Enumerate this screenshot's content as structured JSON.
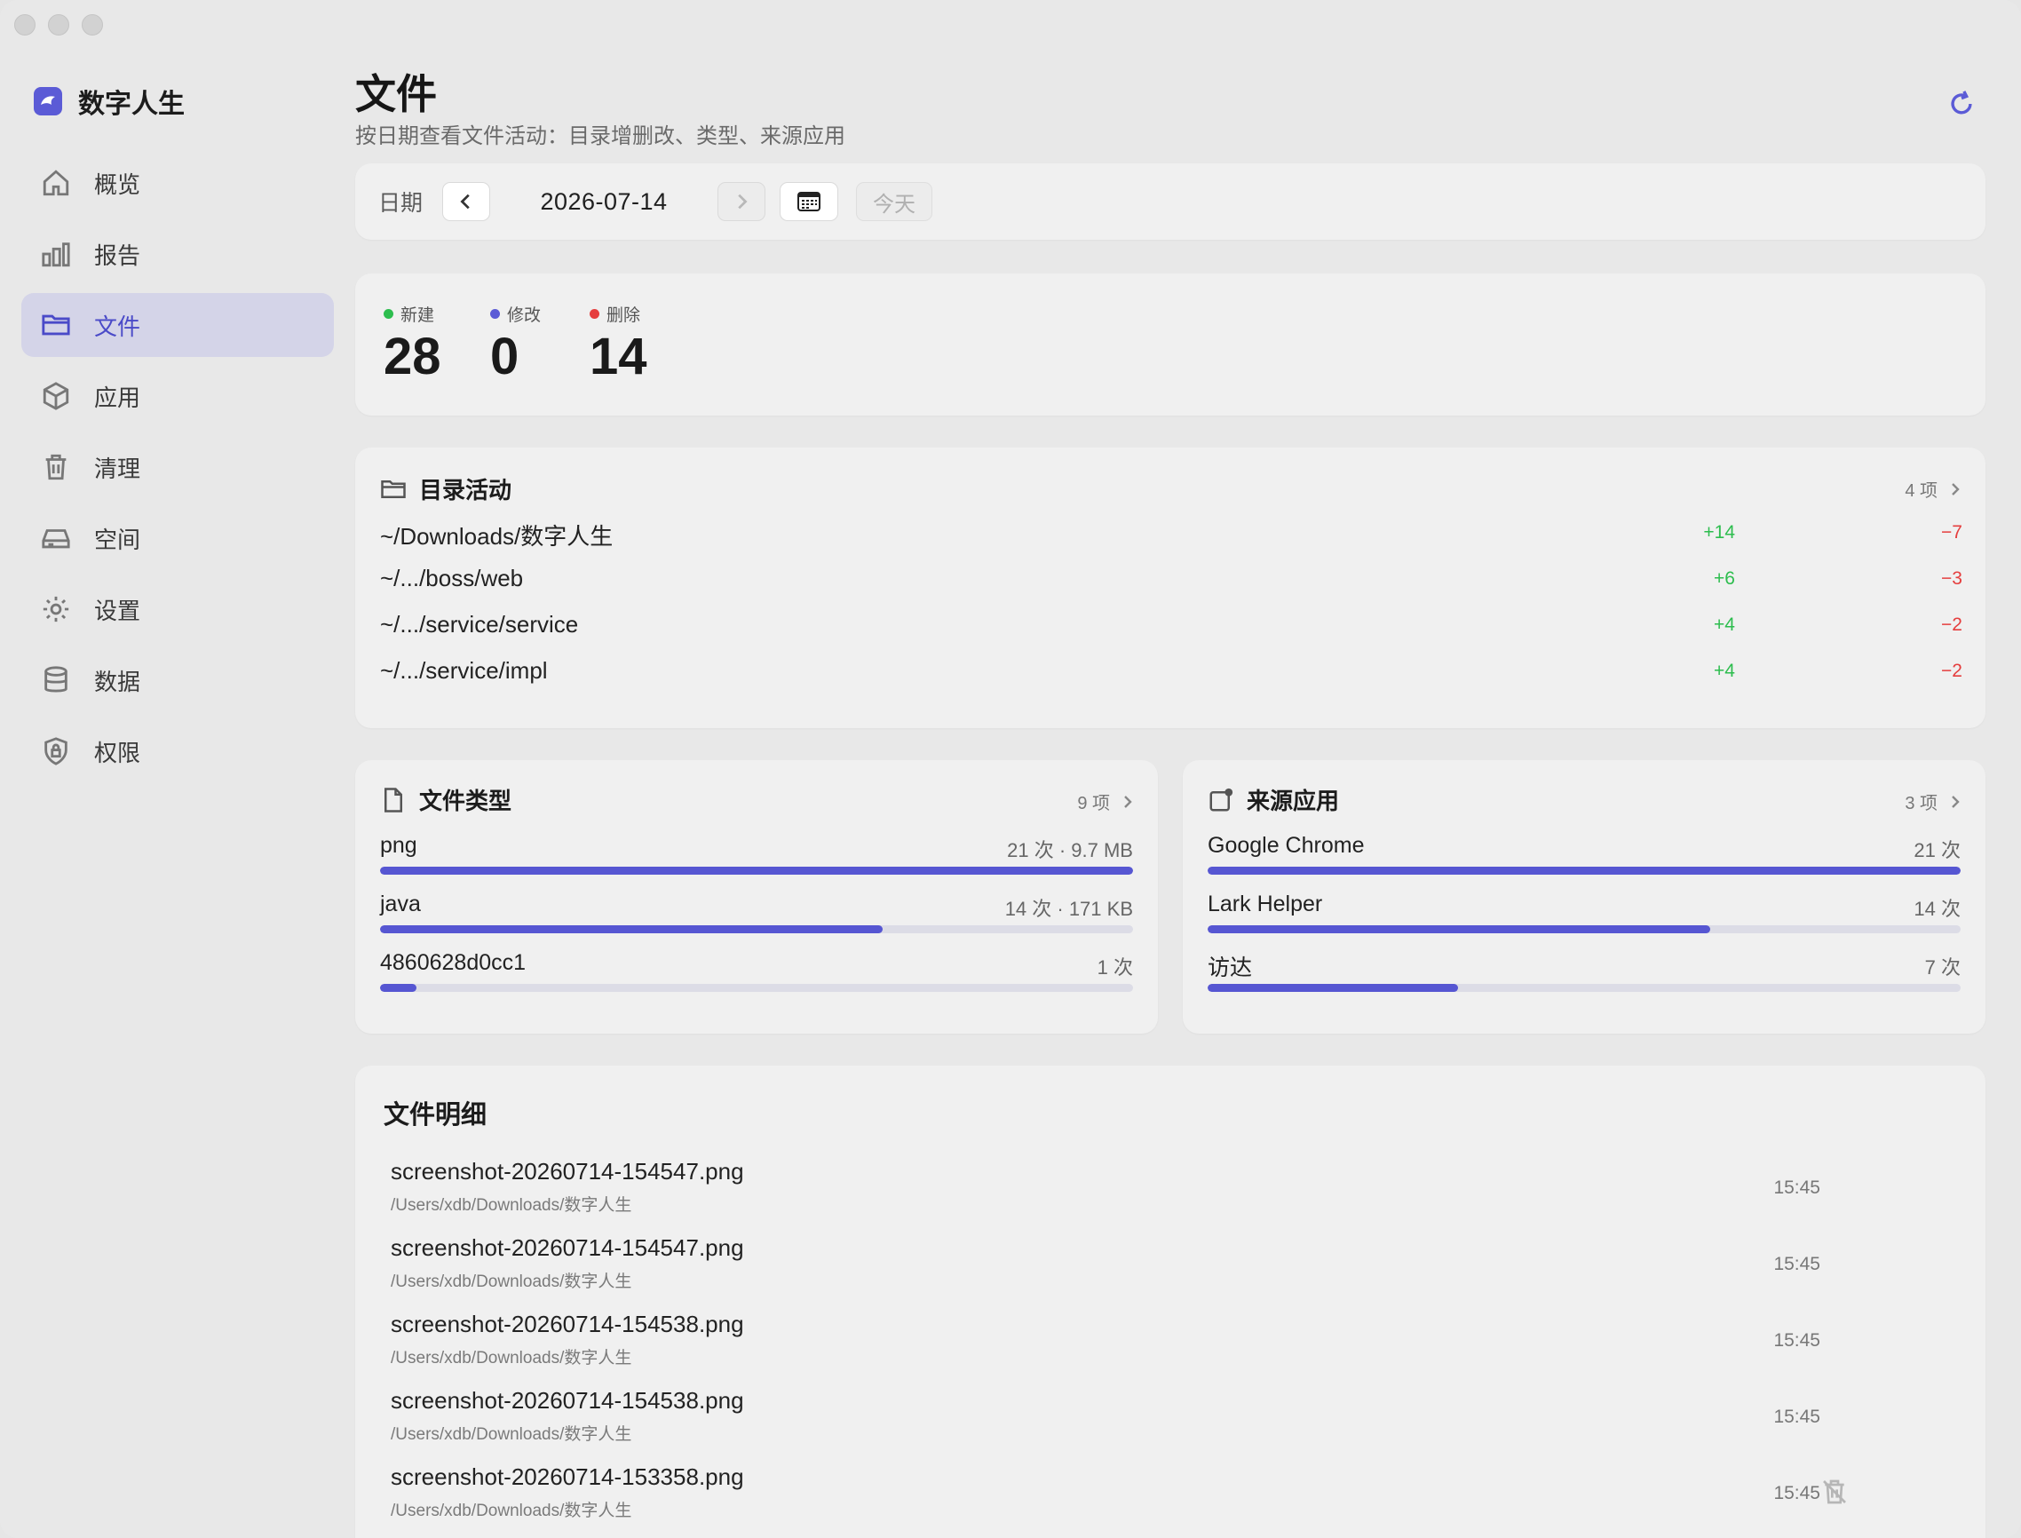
{
  "app": {
    "name": "数字人生",
    "brand_color": "#5b5bd6"
  },
  "sidebar": {
    "items": [
      {
        "label": "概览",
        "icon": "home-icon",
        "active": false
      },
      {
        "label": "报告",
        "icon": "bar-chart-icon",
        "active": false
      },
      {
        "label": "文件",
        "icon": "folder-icon",
        "active": true
      },
      {
        "label": "应用",
        "icon": "box-icon",
        "active": false
      },
      {
        "label": "清理",
        "icon": "trash-icon",
        "active": false
      },
      {
        "label": "空间",
        "icon": "drive-icon",
        "active": false
      },
      {
        "label": "设置",
        "icon": "gear-icon",
        "active": false
      },
      {
        "label": "数据",
        "icon": "database-icon",
        "active": false
      },
      {
        "label": "权限",
        "icon": "shield-lock-icon",
        "active": false
      }
    ]
  },
  "header": {
    "title": "文件",
    "subtitle": "按日期查看文件活动：目录增删改、类型、来源应用"
  },
  "datebar": {
    "label": "日期",
    "date": "2026-07-14",
    "today_label": "今天"
  },
  "stats": [
    {
      "label": "新建",
      "value": "28",
      "color": "#2dbd4e"
    },
    {
      "label": "修改",
      "value": "0",
      "color": "#5b5bd6"
    },
    {
      "label": "删除",
      "value": "14",
      "color": "#e53e3e"
    }
  ],
  "dirs": {
    "title": "目录活动",
    "count": "4 项",
    "rows": [
      {
        "path": "~/Downloads/数字人生",
        "added": "+14",
        "removed": "−7"
      },
      {
        "path": "~/.../boss/web",
        "added": "+6",
        "removed": "−3"
      },
      {
        "path": "~/.../service/service",
        "added": "+4",
        "removed": "−2"
      },
      {
        "path": "~/.../service/impl",
        "added": "+4",
        "removed": "−2"
      }
    ]
  },
  "types": {
    "title": "文件类型",
    "count": "9 项",
    "rows": [
      {
        "name": "png",
        "value": "21 次 · 9.7 MB",
        "fraction": 1.0
      },
      {
        "name": "java",
        "value": "14 次 · 171 KB",
        "fraction": 0.667
      },
      {
        "name": "4860628d0cc1",
        "value": "1 次",
        "fraction": 0.048
      }
    ]
  },
  "sources": {
    "title": "来源应用",
    "count": "3 项",
    "rows": [
      {
        "name": "Google Chrome",
        "value": "21 次",
        "fraction": 1.0
      },
      {
        "name": "Lark Helper",
        "value": "14 次",
        "fraction": 0.667
      },
      {
        "name": "访达",
        "value": "7 次",
        "fraction": 0.333
      }
    ]
  },
  "details": {
    "title": "文件明细",
    "files": [
      {
        "name": "screenshot-20260714-154547.png",
        "path": "/Users/xdb/Downloads/数字人生",
        "time": "15:45",
        "trash": false
      },
      {
        "name": "screenshot-20260714-154547.png",
        "path": "/Users/xdb/Downloads/数字人生",
        "time": "15:45",
        "trash": false
      },
      {
        "name": "screenshot-20260714-154538.png",
        "path": "/Users/xdb/Downloads/数字人生",
        "time": "15:45",
        "trash": false
      },
      {
        "name": "screenshot-20260714-154538.png",
        "path": "/Users/xdb/Downloads/数字人生",
        "time": "15:45",
        "trash": false
      },
      {
        "name": "screenshot-20260714-153358.png",
        "path": "/Users/xdb/Downloads/数字人生",
        "time": "15:45",
        "trash": true
      }
    ]
  }
}
